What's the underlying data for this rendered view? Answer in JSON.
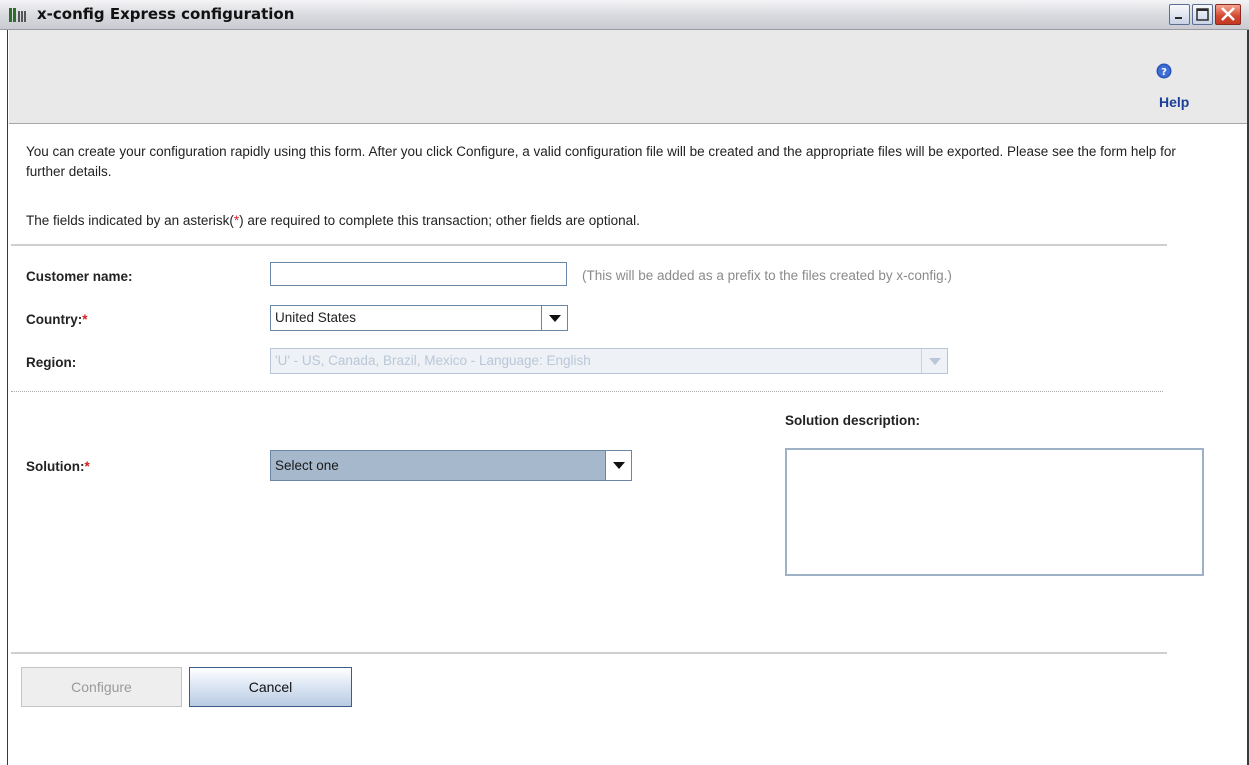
{
  "window": {
    "title": "x-config Express configuration",
    "controls": {
      "minimize_icon": "minimize-icon",
      "maximize_icon": "maximize-icon",
      "close_icon": "close-icon"
    }
  },
  "toolbar": {
    "help_label": "Help",
    "help_icon": "help-icon"
  },
  "intro": {
    "text": "You can create your configuration rapidly using this form. After you click Configure, a valid configuration file will be created and the appropriate files will be exported. Please see the form help for further details.",
    "required_prefix": "The fields indicated by an asterisk(",
    "required_star": "*",
    "required_suffix": ") are required to complete this transaction; other fields are optional."
  },
  "form": {
    "customer_name": {
      "label": "Customer name:",
      "value": "",
      "hint": "(This will be added as a prefix to the files created by x-config.)"
    },
    "country": {
      "label": "Country:",
      "star": "*",
      "value": "United States"
    },
    "region": {
      "label": "Region:",
      "value": "'U' - US, Canada, Brazil, Mexico - Language: English",
      "enabled": false
    },
    "solution": {
      "label": "Solution:",
      "star": "*",
      "value": "Select one"
    },
    "solution_description": {
      "label": "Solution description:",
      "value": ""
    }
  },
  "buttons": {
    "configure": "Configure",
    "cancel": "Cancel"
  },
  "colors": {
    "required": "#d62020",
    "help_link": "#1d3f9a",
    "selected_combo": "#a6b8cc"
  }
}
